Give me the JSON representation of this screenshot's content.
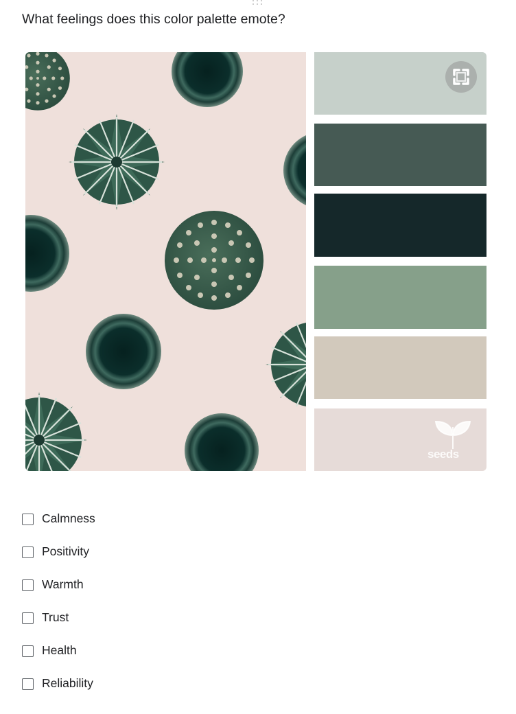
{
  "question": {
    "title": "What feelings does this color palette emote?"
  },
  "image": {
    "fullscreen_icon": "fullscreen-icon",
    "watermark_text": "seeds",
    "swatch_colors": [
      "#c6d0ca",
      "#465a54",
      "#15282a",
      "#86a08a",
      "#d2c9bc",
      "#e6dbd8"
    ],
    "background_color": "#efe0db"
  },
  "options": [
    {
      "label": "Calmness",
      "checked": false
    },
    {
      "label": "Positivity",
      "checked": false
    },
    {
      "label": "Warmth",
      "checked": false
    },
    {
      "label": "Trust",
      "checked": false
    },
    {
      "label": "Health",
      "checked": false
    },
    {
      "label": "Reliability",
      "checked": false
    }
  ]
}
